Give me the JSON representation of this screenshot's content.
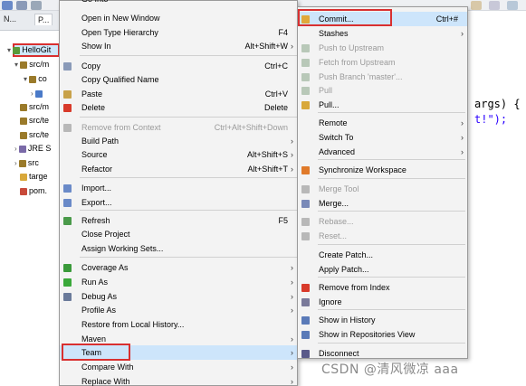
{
  "ide": {
    "tabs": [
      "N...",
      "P..."
    ],
    "tree": [
      {
        "label": "HelloGit",
        "color": "#5a9a3a"
      },
      {
        "label": "src/m",
        "color": "#9a7a2a"
      },
      {
        "label": "co",
        "color": "#9a7a2a"
      },
      {
        "label": "",
        "color": "#4a7ac8"
      },
      {
        "label": "src/m",
        "color": "#9a7a2a"
      },
      {
        "label": "src/te",
        "color": "#9a7a2a"
      },
      {
        "label": "src/te",
        "color": "#9a7a2a"
      },
      {
        "label": "JRE S",
        "color": "#7a6aa8"
      },
      {
        "label": "src",
        "color": "#9a7a2a"
      },
      {
        "label": "targe",
        "color": "#d8a83a"
      },
      {
        "label": "pom.",
        "color": "#c84a3a"
      }
    ],
    "code_line1": "args) {",
    "code_line2": "t!\");",
    "watermark": "CSDN @清风微凉 aaa"
  },
  "left_menu": {
    "items": [
      {
        "label": "Go Into",
        "shortcut": "",
        "arrow": false,
        "disabled": false,
        "icon": ""
      },
      {
        "label": "Open in New Window",
        "shortcut": "",
        "arrow": false,
        "disabled": false,
        "icon": ""
      },
      {
        "label": "Open Type Hierarchy",
        "shortcut": "F4",
        "arrow": false,
        "disabled": false,
        "icon": ""
      },
      {
        "label": "Show In",
        "shortcut": "Alt+Shift+W",
        "arrow": true,
        "disabled": false,
        "icon": ""
      },
      {
        "label": "Copy",
        "shortcut": "Ctrl+C",
        "arrow": false,
        "disabled": false,
        "icon": "#8a9ab8"
      },
      {
        "label": "Copy Qualified Name",
        "shortcut": "",
        "arrow": false,
        "disabled": false,
        "icon": ""
      },
      {
        "label": "Paste",
        "shortcut": "Ctrl+V",
        "arrow": false,
        "disabled": false,
        "icon": "#c8a24a"
      },
      {
        "label": "Delete",
        "shortcut": "Delete",
        "arrow": false,
        "disabled": false,
        "icon": "#d83a2a"
      },
      {
        "label": "Remove from Context",
        "shortcut": "Ctrl+Alt+Shift+Down",
        "arrow": false,
        "disabled": true,
        "icon": "#b8b8b8"
      },
      {
        "label": "Build Path",
        "shortcut": "",
        "arrow": true,
        "disabled": false,
        "icon": ""
      },
      {
        "label": "Source",
        "shortcut": "Alt+Shift+S",
        "arrow": true,
        "disabled": false,
        "icon": ""
      },
      {
        "label": "Refactor",
        "shortcut": "Alt+Shift+T",
        "arrow": true,
        "disabled": false,
        "icon": ""
      },
      {
        "label": "Import...",
        "shortcut": "",
        "arrow": false,
        "disabled": false,
        "icon": "#6a8ac8"
      },
      {
        "label": "Export...",
        "shortcut": "",
        "arrow": false,
        "disabled": false,
        "icon": "#6a8ac8"
      },
      {
        "label": "Refresh",
        "shortcut": "F5",
        "arrow": false,
        "disabled": false,
        "icon": "#4a9a4a"
      },
      {
        "label": "Close Project",
        "shortcut": "",
        "arrow": false,
        "disabled": false,
        "icon": ""
      },
      {
        "label": "Assign Working Sets...",
        "shortcut": "",
        "arrow": false,
        "disabled": false,
        "icon": ""
      },
      {
        "label": "Coverage As",
        "shortcut": "",
        "arrow": true,
        "disabled": false,
        "icon": "#3a9a3a"
      },
      {
        "label": "Run As",
        "shortcut": "",
        "arrow": true,
        "disabled": false,
        "icon": "#3aa83a"
      },
      {
        "label": "Debug As",
        "shortcut": "",
        "arrow": true,
        "disabled": false,
        "icon": "#6a7a9a"
      },
      {
        "label": "Profile As",
        "shortcut": "",
        "arrow": true,
        "disabled": false,
        "icon": ""
      },
      {
        "label": "Restore from Local History...",
        "shortcut": "",
        "arrow": false,
        "disabled": false,
        "icon": ""
      },
      {
        "label": "Maven",
        "shortcut": "",
        "arrow": true,
        "disabled": false,
        "icon": ""
      },
      {
        "label": "Team",
        "shortcut": "",
        "arrow": true,
        "disabled": false,
        "icon": ""
      },
      {
        "label": "Compare With",
        "shortcut": "",
        "arrow": true,
        "disabled": false,
        "icon": ""
      },
      {
        "label": "Replace With",
        "shortcut": "",
        "arrow": true,
        "disabled": false,
        "icon": ""
      }
    ]
  },
  "right_menu": {
    "items": [
      {
        "label": "Commit...",
        "shortcut": "Ctrl+#",
        "arrow": false,
        "disabled": false,
        "icon": "#e0a83a"
      },
      {
        "label": "Stashes",
        "shortcut": "",
        "arrow": true,
        "disabled": false,
        "icon": ""
      },
      {
        "label": "Push to Upstream",
        "shortcut": "",
        "arrow": false,
        "disabled": true,
        "icon": "#b8c8b8"
      },
      {
        "label": "Fetch from Upstream",
        "shortcut": "",
        "arrow": false,
        "disabled": true,
        "icon": "#b8c8b8"
      },
      {
        "label": "Push Branch 'master'...",
        "shortcut": "",
        "arrow": false,
        "disabled": true,
        "icon": "#b8c8b8"
      },
      {
        "label": "Pull",
        "shortcut": "",
        "arrow": false,
        "disabled": true,
        "icon": "#b8c8b8"
      },
      {
        "label": "Pull...",
        "shortcut": "",
        "arrow": false,
        "disabled": false,
        "icon": "#d8a83a"
      },
      {
        "label": "Remote",
        "shortcut": "",
        "arrow": true,
        "disabled": false,
        "icon": ""
      },
      {
        "label": "Switch To",
        "shortcut": "",
        "arrow": true,
        "disabled": false,
        "icon": ""
      },
      {
        "label": "Advanced",
        "shortcut": "",
        "arrow": true,
        "disabled": false,
        "icon": ""
      },
      {
        "label": "Synchronize Workspace",
        "shortcut": "",
        "arrow": false,
        "disabled": false,
        "icon": "#e07a2a"
      },
      {
        "label": "Merge Tool",
        "shortcut": "",
        "arrow": false,
        "disabled": true,
        "icon": "#b8b8b8"
      },
      {
        "label": "Merge...",
        "shortcut": "",
        "arrow": false,
        "disabled": false,
        "icon": "#7a8ab8"
      },
      {
        "label": "Rebase...",
        "shortcut": "",
        "arrow": false,
        "disabled": true,
        "icon": "#b8b8b8"
      },
      {
        "label": "Reset...",
        "shortcut": "",
        "arrow": false,
        "disabled": true,
        "icon": "#b8b8b8"
      },
      {
        "label": "Create Patch...",
        "shortcut": "",
        "arrow": false,
        "disabled": false,
        "icon": ""
      },
      {
        "label": "Apply Patch...",
        "shortcut": "",
        "arrow": false,
        "disabled": false,
        "icon": ""
      },
      {
        "label": "Remove from Index",
        "shortcut": "",
        "arrow": false,
        "disabled": false,
        "icon": "#d83a2a"
      },
      {
        "label": "Ignore",
        "shortcut": "",
        "arrow": false,
        "disabled": false,
        "icon": "#7a7a9a"
      },
      {
        "label": "Show in History",
        "shortcut": "",
        "arrow": false,
        "disabled": false,
        "icon": "#5a7ab8"
      },
      {
        "label": "Show in Repositories View",
        "shortcut": "",
        "arrow": false,
        "disabled": false,
        "icon": "#5a7ab8"
      },
      {
        "label": "Disconnect",
        "shortcut": "",
        "arrow": false,
        "disabled": false,
        "icon": "#5a5a8a"
      }
    ]
  },
  "colors": {
    "highlight": "#cde5fb",
    "red_box": "#d93030"
  }
}
